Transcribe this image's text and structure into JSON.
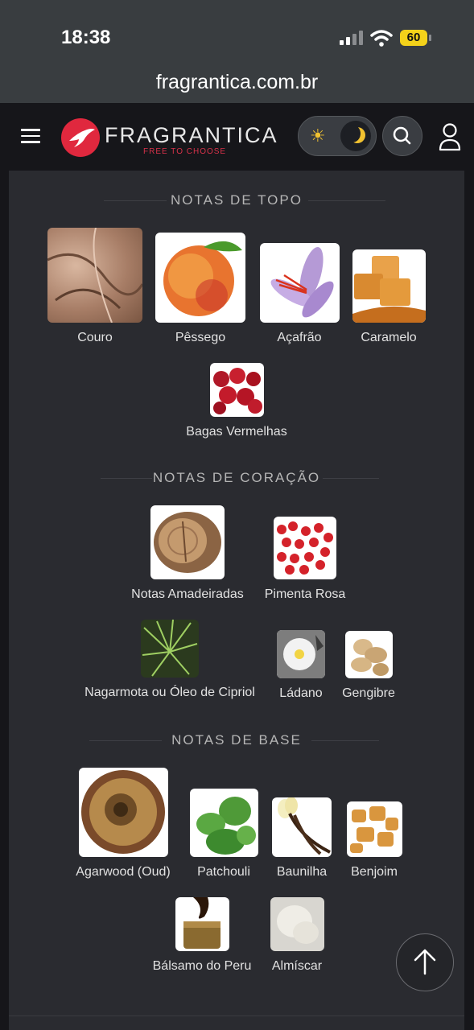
{
  "status_bar": {
    "time": "18:38",
    "battery": "60"
  },
  "browser": {
    "url": "fragrantica.com.br"
  },
  "header": {
    "brand": "FRAGRANTICA",
    "tagline": "FREE TO CHOOSE",
    "icons": [
      "menu-icon",
      "hummingbird-logo",
      "sun-icon",
      "moon-icon",
      "search-icon",
      "user-icon"
    ]
  },
  "sections": {
    "top": {
      "title": "NOTAS DE TOPO",
      "notes": [
        "Couro",
        "Pêssego",
        "Açafrão",
        "Caramelo",
        "Bagas Vermelhas"
      ]
    },
    "heart": {
      "title": "NOTAS DE CORAÇÃO",
      "notes": [
        "Notas Amadeiradas",
        "Pimenta Rosa",
        "Nagarmota ou Óleo de Cipriol",
        "Ládano",
        "Gengibre"
      ]
    },
    "base": {
      "title": "NOTAS DE BASE",
      "notes": [
        "Agarwood (Oud)",
        "Patchouli",
        "Baunilha",
        "Benjoim",
        "Bálsamo do Peru",
        "Almíscar"
      ]
    }
  },
  "colors": {
    "brand_red": "#e0283e",
    "theme_accent": "#f2c230",
    "panel_bg": "#2a2b30"
  }
}
